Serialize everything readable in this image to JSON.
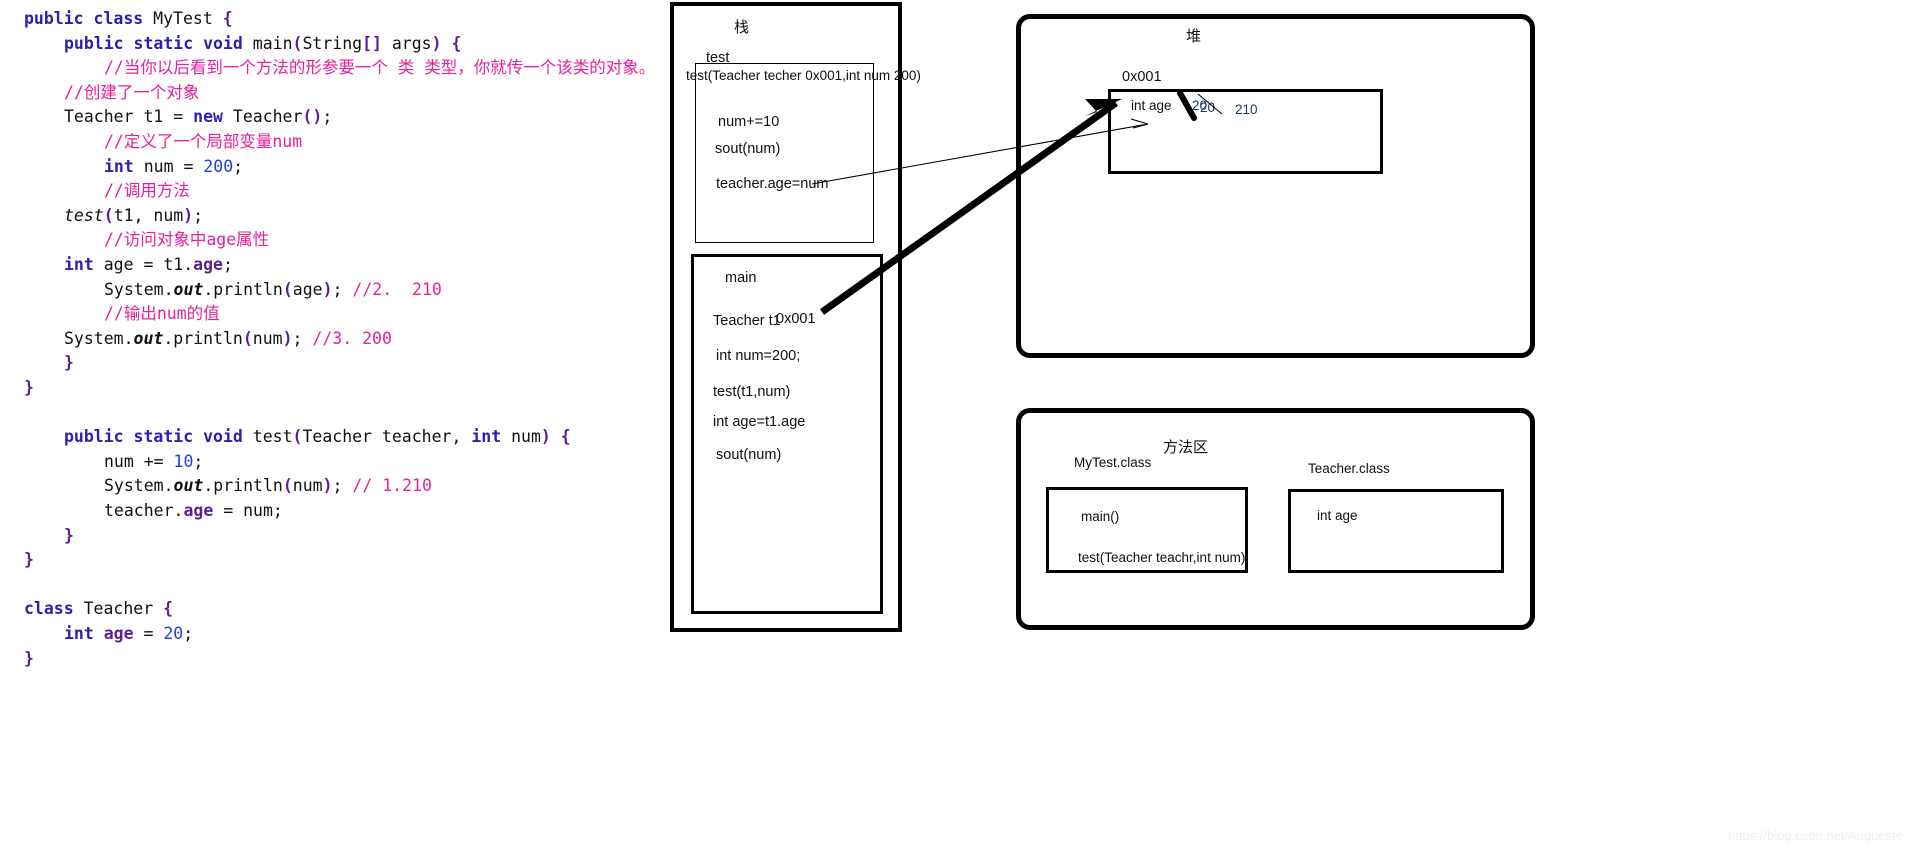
{
  "code": {
    "language": "java",
    "lines": [
      {
        "indent": 0,
        "tokens": [
          {
            "t": "public ",
            "c": "kw"
          },
          {
            "t": "class ",
            "c": "kw"
          },
          {
            "t": "MyTest ",
            "c": "plain"
          },
          {
            "t": "{",
            "c": "brc"
          }
        ]
      },
      {
        "indent": 1,
        "tokens": [
          {
            "t": "public ",
            "c": "kw"
          },
          {
            "t": "static ",
            "c": "kw"
          },
          {
            "t": "void ",
            "c": "kw"
          },
          {
            "t": "main",
            "c": "plain"
          },
          {
            "t": "(",
            "c": "brc"
          },
          {
            "t": "String",
            "c": "plain"
          },
          {
            "t": "[]",
            "c": "brc"
          },
          {
            "t": " args",
            "c": "plain"
          },
          {
            "t": ")",
            "c": "brc"
          },
          {
            "t": " ",
            "c": "plain"
          },
          {
            "t": "{",
            "c": "brc"
          }
        ]
      },
      {
        "indent": 2,
        "tokens": [
          {
            "t": "//当你以后看到一个方法的形参要一个 类 类型，你就传一个该类的对象。",
            "c": "cmt"
          }
        ]
      },
      {
        "indent": 1,
        "tokens": [
          {
            "t": "//创建了一个对象",
            "c": "cmt"
          }
        ]
      },
      {
        "indent": 1,
        "tokens": [
          {
            "t": "Teacher t1 = ",
            "c": "plain"
          },
          {
            "t": "new ",
            "c": "kw"
          },
          {
            "t": "Teacher",
            "c": "plain"
          },
          {
            "t": "()",
            "c": "brc"
          },
          {
            "t": ";",
            "c": "plain"
          }
        ]
      },
      {
        "indent": 2,
        "tokens": [
          {
            "t": "//定义了一个局部变量num",
            "c": "cmt"
          }
        ]
      },
      {
        "indent": 2,
        "tokens": [
          {
            "t": "int ",
            "c": "kw"
          },
          {
            "t": "num = ",
            "c": "plain"
          },
          {
            "t": "200",
            "c": "num"
          },
          {
            "t": ";",
            "c": "plain"
          }
        ]
      },
      {
        "indent": 2,
        "tokens": [
          {
            "t": "//调用方法",
            "c": "cmt"
          }
        ]
      },
      {
        "indent": 1,
        "tokens": [
          {
            "t": "test",
            "c": "mth"
          },
          {
            "t": "(",
            "c": "brc"
          },
          {
            "t": "t1, num",
            "c": "plain"
          },
          {
            "t": ")",
            "c": "brc"
          },
          {
            "t": ";",
            "c": "plain"
          }
        ]
      },
      {
        "indent": 2,
        "tokens": [
          {
            "t": "//访问对象中age属性",
            "c": "cmt"
          }
        ]
      },
      {
        "indent": 1,
        "tokens": [
          {
            "t": "int ",
            "c": "kw"
          },
          {
            "t": "age = t1.",
            "c": "plain"
          },
          {
            "t": "age",
            "c": "fld"
          },
          {
            "t": ";",
            "c": "plain"
          }
        ]
      },
      {
        "indent": 2,
        "tokens": [
          {
            "t": "System.",
            "c": "plain"
          },
          {
            "t": "out",
            "c": "ital"
          },
          {
            "t": ".println",
            "c": "plain"
          },
          {
            "t": "(",
            "c": "brc"
          },
          {
            "t": "age",
            "c": "plain"
          },
          {
            "t": ")",
            "c": "brc"
          },
          {
            "t": "; ",
            "c": "plain"
          },
          {
            "t": "//2.  210",
            "c": "cmt"
          }
        ]
      },
      {
        "indent": 2,
        "tokens": [
          {
            "t": "//输出num的值",
            "c": "cmt"
          }
        ]
      },
      {
        "indent": 1,
        "tokens": [
          {
            "t": "System.",
            "c": "plain"
          },
          {
            "t": "out",
            "c": "ital"
          },
          {
            "t": ".println",
            "c": "plain"
          },
          {
            "t": "(",
            "c": "brc"
          },
          {
            "t": "num",
            "c": "plain"
          },
          {
            "t": ")",
            "c": "brc"
          },
          {
            "t": "; ",
            "c": "plain"
          },
          {
            "t": "//3. 200",
            "c": "cmt"
          }
        ]
      },
      {
        "indent": 1,
        "tokens": [
          {
            "t": "}",
            "c": "brc"
          }
        ]
      },
      {
        "indent": 0,
        "tokens": [
          {
            "t": "}",
            "c": "brc"
          }
        ]
      },
      {
        "indent": 0,
        "tokens": []
      },
      {
        "indent": 1,
        "tokens": [
          {
            "t": "public ",
            "c": "kw"
          },
          {
            "t": "static ",
            "c": "kw"
          },
          {
            "t": "void ",
            "c": "kw"
          },
          {
            "t": "test",
            "c": "plain"
          },
          {
            "t": "(",
            "c": "brc"
          },
          {
            "t": "Teacher teacher, ",
            "c": "plain"
          },
          {
            "t": "int ",
            "c": "kw"
          },
          {
            "t": "num",
            "c": "plain"
          },
          {
            "t": ")",
            "c": "brc"
          },
          {
            "t": " ",
            "c": "plain"
          },
          {
            "t": "{",
            "c": "brc"
          }
        ]
      },
      {
        "indent": 2,
        "tokens": [
          {
            "t": "num += ",
            "c": "plain"
          },
          {
            "t": "10",
            "c": "num"
          },
          {
            "t": ";",
            "c": "plain"
          }
        ]
      },
      {
        "indent": 2,
        "tokens": [
          {
            "t": "System.",
            "c": "plain"
          },
          {
            "t": "out",
            "c": "ital"
          },
          {
            "t": ".println",
            "c": "plain"
          },
          {
            "t": "(",
            "c": "brc"
          },
          {
            "t": "num",
            "c": "plain"
          },
          {
            "t": ")",
            "c": "brc"
          },
          {
            "t": "; ",
            "c": "plain"
          },
          {
            "t": "// 1.210",
            "c": "cmt"
          }
        ]
      },
      {
        "indent": 2,
        "tokens": [
          {
            "t": "teacher.",
            "c": "plain"
          },
          {
            "t": "age",
            "c": "fld"
          },
          {
            "t": " = num;",
            "c": "plain"
          }
        ]
      },
      {
        "indent": 1,
        "tokens": [
          {
            "t": "}",
            "c": "brc"
          }
        ]
      },
      {
        "indent": 0,
        "tokens": [
          {
            "t": "}",
            "c": "brc"
          }
        ]
      },
      {
        "indent": 0,
        "tokens": []
      },
      {
        "indent": 0,
        "tokens": [
          {
            "t": "class ",
            "c": "kw"
          },
          {
            "t": "Teacher ",
            "c": "plain"
          },
          {
            "t": "{",
            "c": "brc"
          }
        ]
      },
      {
        "indent": 1,
        "tokens": [
          {
            "t": "int ",
            "c": "kw"
          },
          {
            "t": "age",
            "c": "fld"
          },
          {
            "t": " = ",
            "c": "plain"
          },
          {
            "t": "20",
            "c": "num"
          },
          {
            "t": ";",
            "c": "plain"
          }
        ]
      },
      {
        "indent": 0,
        "tokens": [
          {
            "t": "}",
            "c": "brc"
          }
        ]
      }
    ]
  },
  "diagram": {
    "stack": {
      "title": "栈",
      "test_frame": {
        "label": "test",
        "signature": "test(Teacher techer 0x001,int num 200)",
        "lines": [
          "num+=10",
          "sout(num)",
          "teacher.age=num"
        ]
      },
      "main_frame": {
        "label": "main",
        "rows": [
          {
            "name": "Teacher t1",
            "value": "0x001"
          },
          {
            "name": "int num=200;",
            "value": ""
          },
          {
            "name": "test(t1,num)",
            "value": ""
          },
          {
            "name": "int age=t1.age",
            "value": ""
          },
          {
            "name": "sout(num)",
            "value": ""
          }
        ]
      }
    },
    "heap": {
      "title": "堆",
      "object_address": "0x001",
      "field_label": "int age",
      "field_initial_value": "20",
      "field_struck_value": "20",
      "field_final_value": "210"
    },
    "method_area": {
      "title": "方法区",
      "classes": [
        {
          "name": "MyTest.class",
          "members": [
            "main()",
            "test(Teacher teachr,int num)"
          ]
        },
        {
          "name": "Teacher.class",
          "members": [
            "int age"
          ]
        }
      ]
    }
  },
  "watermark": {
    "text": "https://blog.csdn.net/Augueste"
  }
}
